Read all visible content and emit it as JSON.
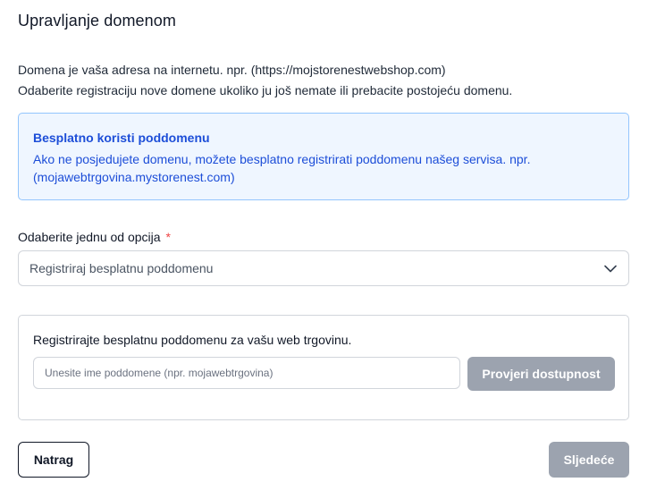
{
  "page": {
    "title": "Upravljanje domenom",
    "description": [
      "Domena je vaša adresa na internetu. npr. (https://mojstorenestwebshop.com)",
      "Odaberite registraciju nove domene ukoliko ju još nemate ili prebacite postojeću domenu."
    ]
  },
  "info_box": {
    "title": "Besplatno koristi poddomenu",
    "body": "Ako ne posjedujete domenu, možete besplatno registrirati poddomenu našeg servisa. npr. (mojawebtrgovina.mystorenest.com)"
  },
  "option": {
    "label": "Odaberite jednu od opcija",
    "required_mark": "*",
    "selected": "Registriraj besplatnu poddomenu"
  },
  "subdomain_panel": {
    "text": "Registrirajte besplatnu poddomenu za vašu web trgovinu.",
    "input_placeholder": "Unesite ime poddomene (npr. mojawebtrgovina)",
    "input_value": "",
    "check_button": "Provjeri dostupnost"
  },
  "footer": {
    "back_button": "Natrag",
    "next_button": "Sljedeće"
  },
  "colors": {
    "accent_blue": "#1d4ed8",
    "disabled_button": "#9ca3af",
    "required": "#ef4444"
  },
  "icons": {
    "select_chevron": "chevron-down-icon"
  }
}
